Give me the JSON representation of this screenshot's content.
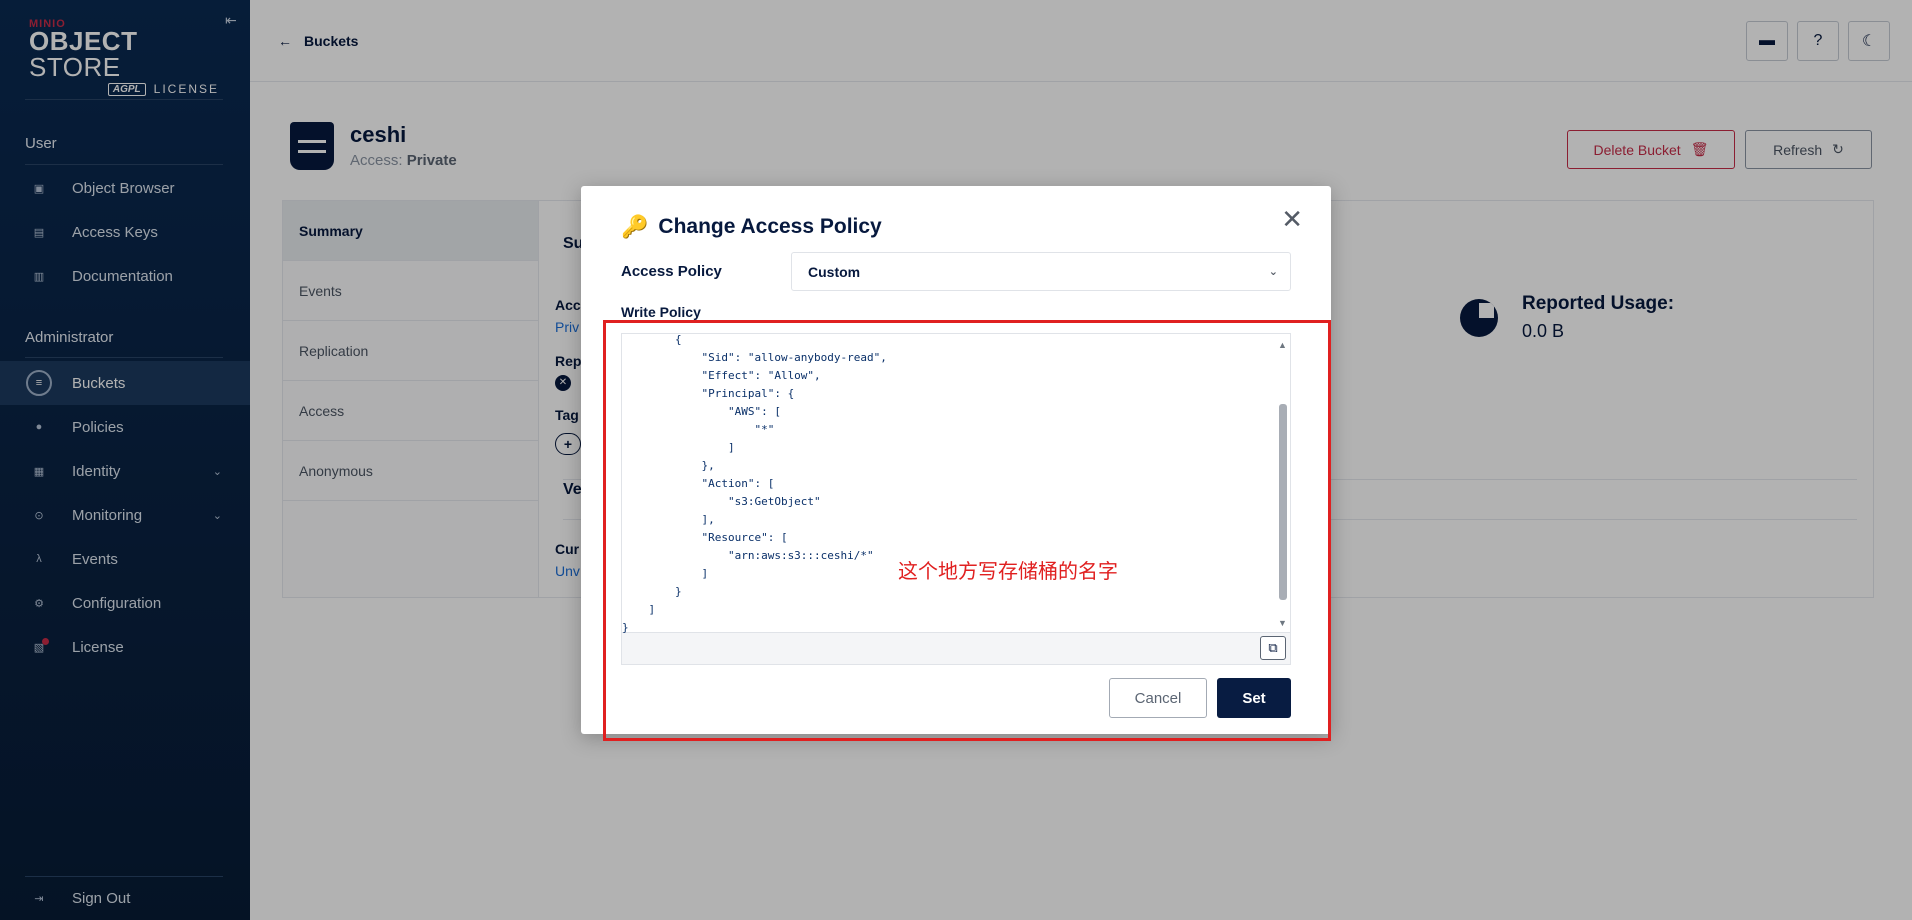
{
  "sidebar": {
    "logo": {
      "brand": "MINIO",
      "product_bold": "OBJECT",
      "product_light": "STORE",
      "agpl": "AGPL",
      "license": "LICENSE"
    },
    "sections": {
      "user": "User",
      "admin": "Administrator"
    },
    "items": {
      "object_browser": "Object Browser",
      "access_keys": "Access Keys",
      "documentation": "Documentation",
      "buckets": "Buckets",
      "policies": "Policies",
      "identity": "Identity",
      "monitoring": "Monitoring",
      "events": "Events",
      "configuration": "Configuration",
      "license": "License",
      "sign_out": "Sign Out"
    }
  },
  "topbar": {
    "back_label": "Buckets"
  },
  "bucket": {
    "name": "ceshi",
    "access_label": "Access:",
    "access_value": "Private",
    "delete_label": "Delete Bucket",
    "refresh_label": "Refresh"
  },
  "tabs": [
    "Summary",
    "Events",
    "Replication",
    "Access",
    "Anonymous"
  ],
  "summary_peek": {
    "heading": "Su",
    "acc": "Acc",
    "priv": "Priv",
    "rep": "Rep",
    "tag": "Tag",
    "ve": "Ve",
    "cur": "Cur",
    "unv": "Unv"
  },
  "usage": {
    "label": "Reported Usage:",
    "value": "0.0 B"
  },
  "modal": {
    "title": "Change Access Policy",
    "access_policy_label": "Access Policy",
    "access_policy_value": "Custom",
    "write_policy_label": "Write Policy",
    "cancel_label": "Cancel",
    "set_label": "Set",
    "code_lines": [
      "        {",
      "            \"Sid\": \"allow-anybody-read\",",
      "            \"Effect\": \"Allow\",",
      "            \"Principal\": {",
      "                \"AWS\": [",
      "                    \"*\"",
      "                ]",
      "            },",
      "            \"Action\": [",
      "                \"s3:GetObject\"",
      "            ],",
      "            \"Resource\": [",
      "                \"arn:aws:s3:::ceshi/*\"",
      "            ]",
      "        }",
      "    ]",
      "}"
    ]
  },
  "annotation": {
    "note": "这个地方写存储桶的名字",
    "color": "#e02020"
  }
}
